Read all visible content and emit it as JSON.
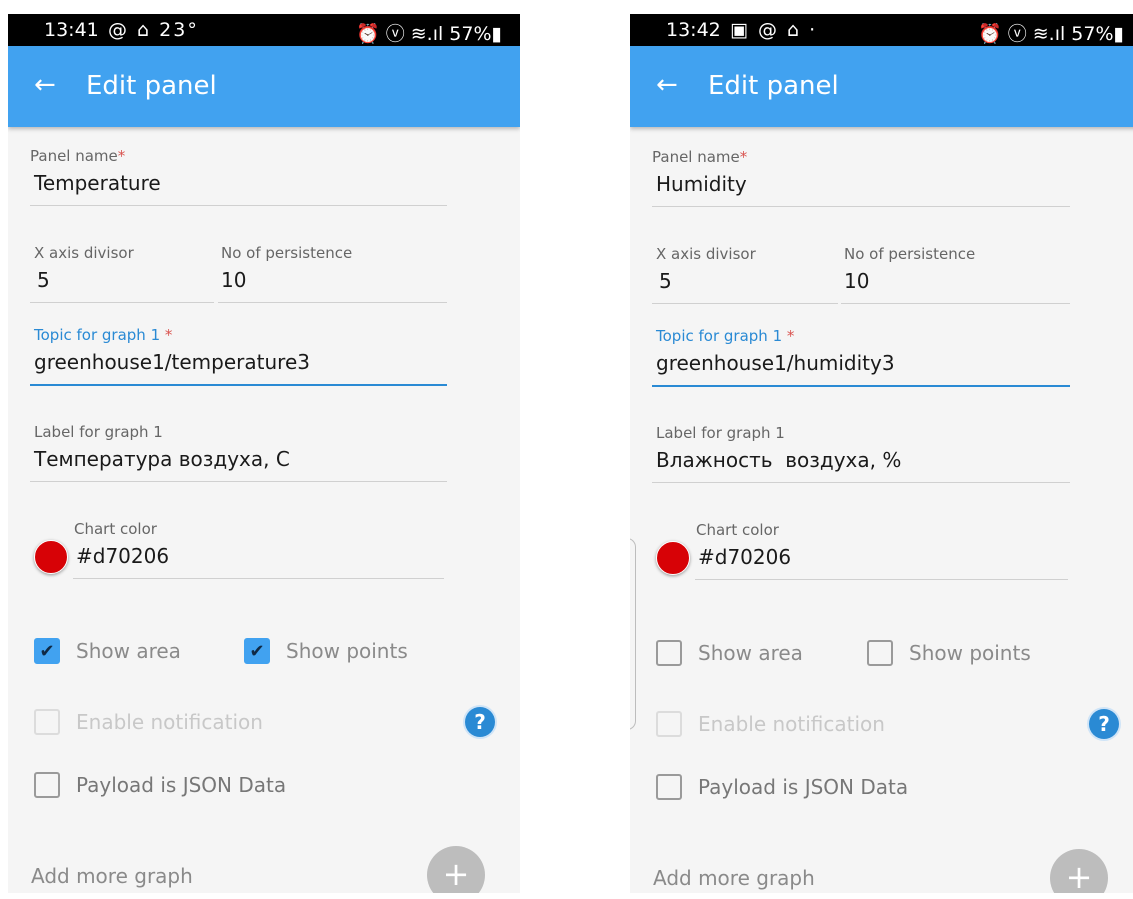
{
  "screens": [
    {
      "status": {
        "time": "13:41",
        "icons": "@ ⌂ 23°",
        "right": "⏰ ⓥ ≋.ıl 57%▮"
      },
      "appbar": {
        "title": "Edit panel"
      },
      "panel_name": {
        "label": "Panel name",
        "value": "Temperature"
      },
      "x_axis": {
        "label": "X axis divisor",
        "value": "5"
      },
      "persistence": {
        "label": "No of persistence",
        "value": "10"
      },
      "topic": {
        "label": "Topic for graph 1",
        "value": "greenhouse1/temperature3"
      },
      "graph_label": {
        "label": "Label for graph 1",
        "value": "Температура воздуха, С"
      },
      "chart_color": {
        "label": "Chart color",
        "value": "#d70206",
        "color": "#d70206"
      },
      "show_area": {
        "label": "Show area",
        "checked": true
      },
      "show_points": {
        "label": "Show points",
        "checked": true
      },
      "notification": {
        "label": "Enable notification",
        "checked": false
      },
      "payload_json": {
        "label": "Payload is JSON Data",
        "checked": false
      },
      "add_more": {
        "label": "Add more graph"
      }
    },
    {
      "status": {
        "time": "13:42",
        "icons": "▣ @ ⌂ ·",
        "right": "⏰ ⓥ ≋.ıl 57%▮"
      },
      "appbar": {
        "title": "Edit panel"
      },
      "panel_name": {
        "label": "Panel name",
        "value": "Humidity"
      },
      "x_axis": {
        "label": "X axis divisor",
        "value": "5"
      },
      "persistence": {
        "label": "No of persistence",
        "value": "10"
      },
      "topic": {
        "label": "Topic for graph 1",
        "value": "greenhouse1/humidity3"
      },
      "graph_label": {
        "label": "Label for graph 1",
        "value": "Влажность  воздуха, %"
      },
      "chart_color": {
        "label": "Chart color",
        "value": "#d70206",
        "color": "#d70206"
      },
      "show_area": {
        "label": "Show area",
        "checked": false
      },
      "show_points": {
        "label": "Show points",
        "checked": false
      },
      "notification": {
        "label": "Enable notification",
        "checked": false
      },
      "payload_json": {
        "label": "Payload is JSON Data",
        "checked": false
      },
      "add_more": {
        "label": "Add more graph"
      }
    }
  ],
  "icons": {
    "back": "arrow-left",
    "help": "question-circle",
    "add": "plus"
  },
  "colors": {
    "primary": "#41a2f0",
    "focus": "#2a8ad4",
    "chart": "#d70206"
  }
}
